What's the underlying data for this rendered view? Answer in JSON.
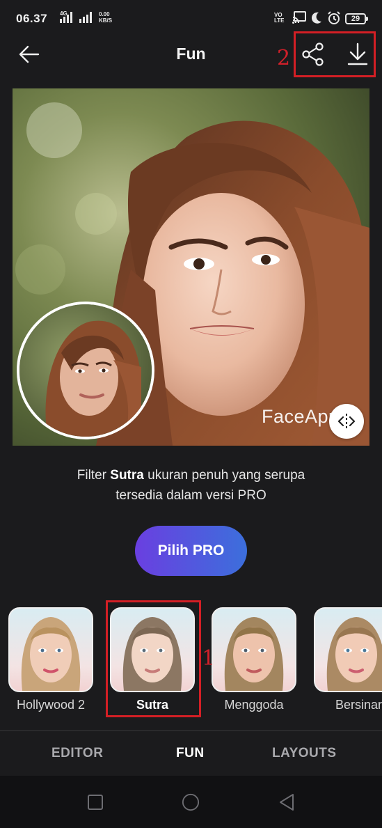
{
  "status_bar": {
    "time": "06.37",
    "network_type": "4G",
    "net_speed_value": "0.00",
    "net_speed_unit": "KB/S",
    "volte_top": "VO",
    "volte_bottom": "LTE",
    "battery": "29"
  },
  "app_bar": {
    "title": "Fun",
    "annotation": "2"
  },
  "photo": {
    "watermark": "FaceApp"
  },
  "description": {
    "prefix": "Filter ",
    "filter_name": "Sutra",
    "line1_suffix": " ukuran penuh yang serupa",
    "line2": "tersedia dalam versi PRO"
  },
  "pro_button": {
    "label": "Pilih PRO"
  },
  "filters": [
    {
      "label": "Hollywood 2",
      "selected": false
    },
    {
      "label": "Sutra",
      "selected": true
    },
    {
      "label": "Menggoda",
      "selected": false
    },
    {
      "label": "Bersinar",
      "selected": false
    }
  ],
  "filter_annotation": "1",
  "tabs": [
    {
      "label": "EDITOR",
      "active": false
    },
    {
      "label": "FUN",
      "active": true
    },
    {
      "label": "LAYOUTS",
      "active": false
    }
  ],
  "colors": {
    "background": "#1b1b1d",
    "annotation_red": "#d41f25",
    "pro_gradient_start": "#6a3fe0",
    "pro_gradient_end": "#3c6fdc"
  },
  "icons": {
    "back": "arrow-left-icon",
    "share": "share-icon",
    "download": "download-icon",
    "compare": "compare-arrows-icon"
  }
}
